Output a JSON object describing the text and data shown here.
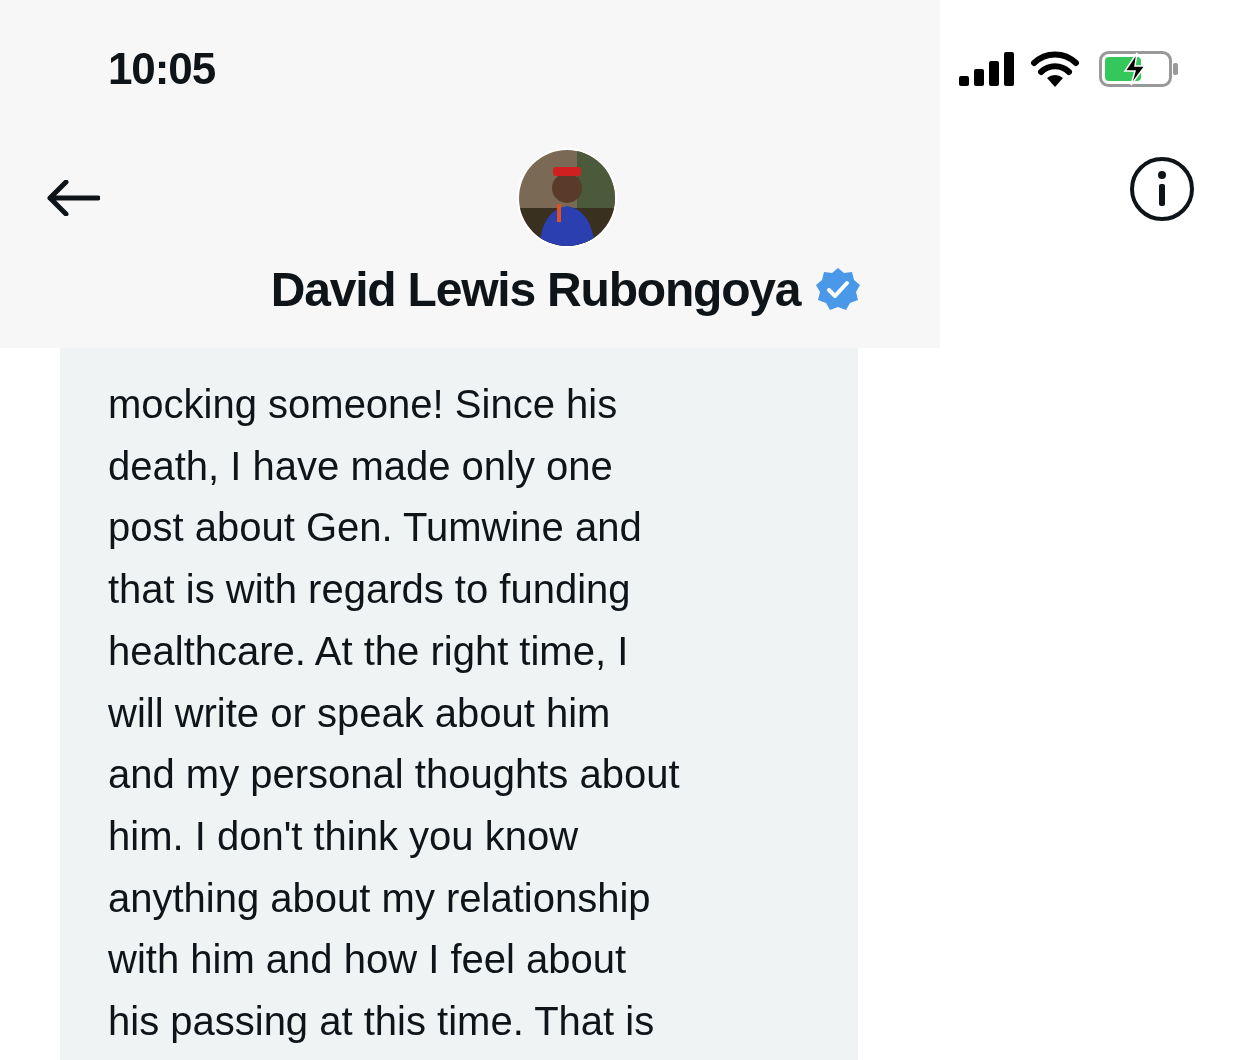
{
  "status_bar": {
    "time": "10:05"
  },
  "header": {
    "name": "David Lewis Rubongoya",
    "verified": true
  },
  "message": {
    "text": "mocking someone! Since his\ndeath, I have made only one\npost about Gen. Tumwine and\nthat is with regards to funding\nhealthcare. At the right time, I\nwill write or speak about him\nand my personal thoughts about\nhim. I don't think you know\nanything about my relationship\nwith him and how I feel about\nhis passing at this time. That is"
  }
}
